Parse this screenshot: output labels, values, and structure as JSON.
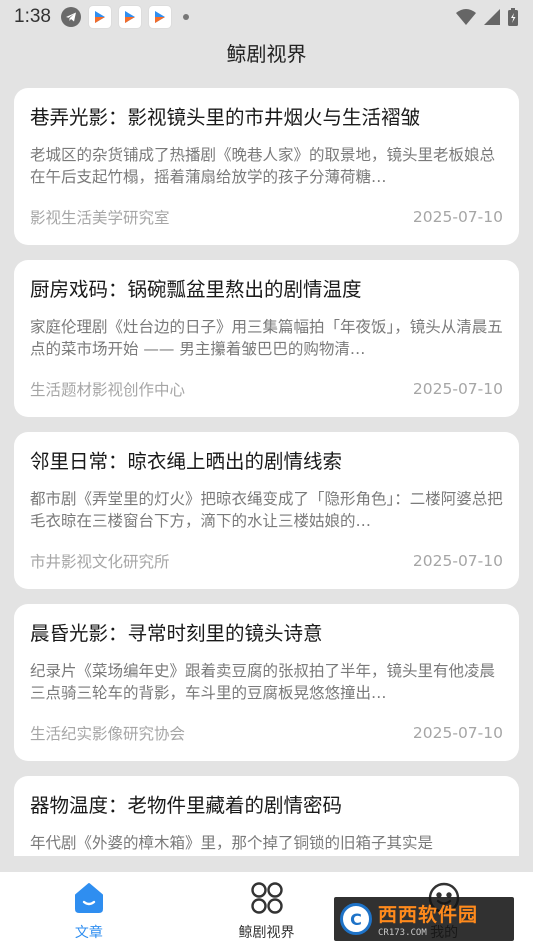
{
  "status_bar": {
    "time": "1:38"
  },
  "header": {
    "title": "鲸剧视界"
  },
  "articles": [
    {
      "title": "巷弄光影：影视镜头里的市井烟火与生活褶皱",
      "summary": "老城区的杂货铺成了热播剧《晚巷人家》的取景地，镜头里老板娘总在午后支起竹榻，摇着蒲扇给放学的孩子分薄荷糖…",
      "source": "影视生活美学研究室",
      "date": "2025-07-10"
    },
    {
      "title": "厨房戏码：锅碗瓢盆里熬出的剧情温度",
      "summary": "家庭伦理剧《灶台边的日子》用三集篇幅拍「年夜饭」，镜头从清晨五点的菜市场开始 —— 男主攥着皱巴巴的购物清…",
      "source": "生活题材影视创作中心",
      "date": "2025-07-10"
    },
    {
      "title": "邻里日常：晾衣绳上晒出的剧情线索",
      "summary": "都市剧《弄堂里的灯火》把晾衣绳变成了「隐形角色」：二楼阿婆总把毛衣晾在三楼窗台下方，滴下的水让三楼姑娘的…",
      "source": "市井影视文化研究所",
      "date": "2025-07-10"
    },
    {
      "title": "晨昏光影：寻常时刻里的镜头诗意",
      "summary": "纪录片《菜场编年史》跟着卖豆腐的张叔拍了半年，镜头里有他凌晨三点骑三轮车的背影，车斗里的豆腐板晃悠悠撞出…",
      "source": "生活纪实影像研究协会",
      "date": "2025-07-10"
    },
    {
      "title": "器物温度：老物件里藏着的剧情密码",
      "summary": "年代剧《外婆的樟木箱》里，那个掉了铜锁的旧箱子其实是",
      "source": "",
      "date": ""
    }
  ],
  "bottom_nav": {
    "items": [
      {
        "label": "文章",
        "icon": "home-icon",
        "active": true
      },
      {
        "label": "鲸剧视界",
        "icon": "grid-icon",
        "active": false
      },
      {
        "label": "我的",
        "icon": "smiley-icon",
        "active": false
      }
    ]
  },
  "watermark": {
    "brand": "西西软件园",
    "url": "CR173.COM"
  },
  "colors": {
    "accent": "#2f8ef0",
    "background": "#e3e3e3",
    "card": "#ffffff",
    "muted_text": "#a6a6a6"
  }
}
